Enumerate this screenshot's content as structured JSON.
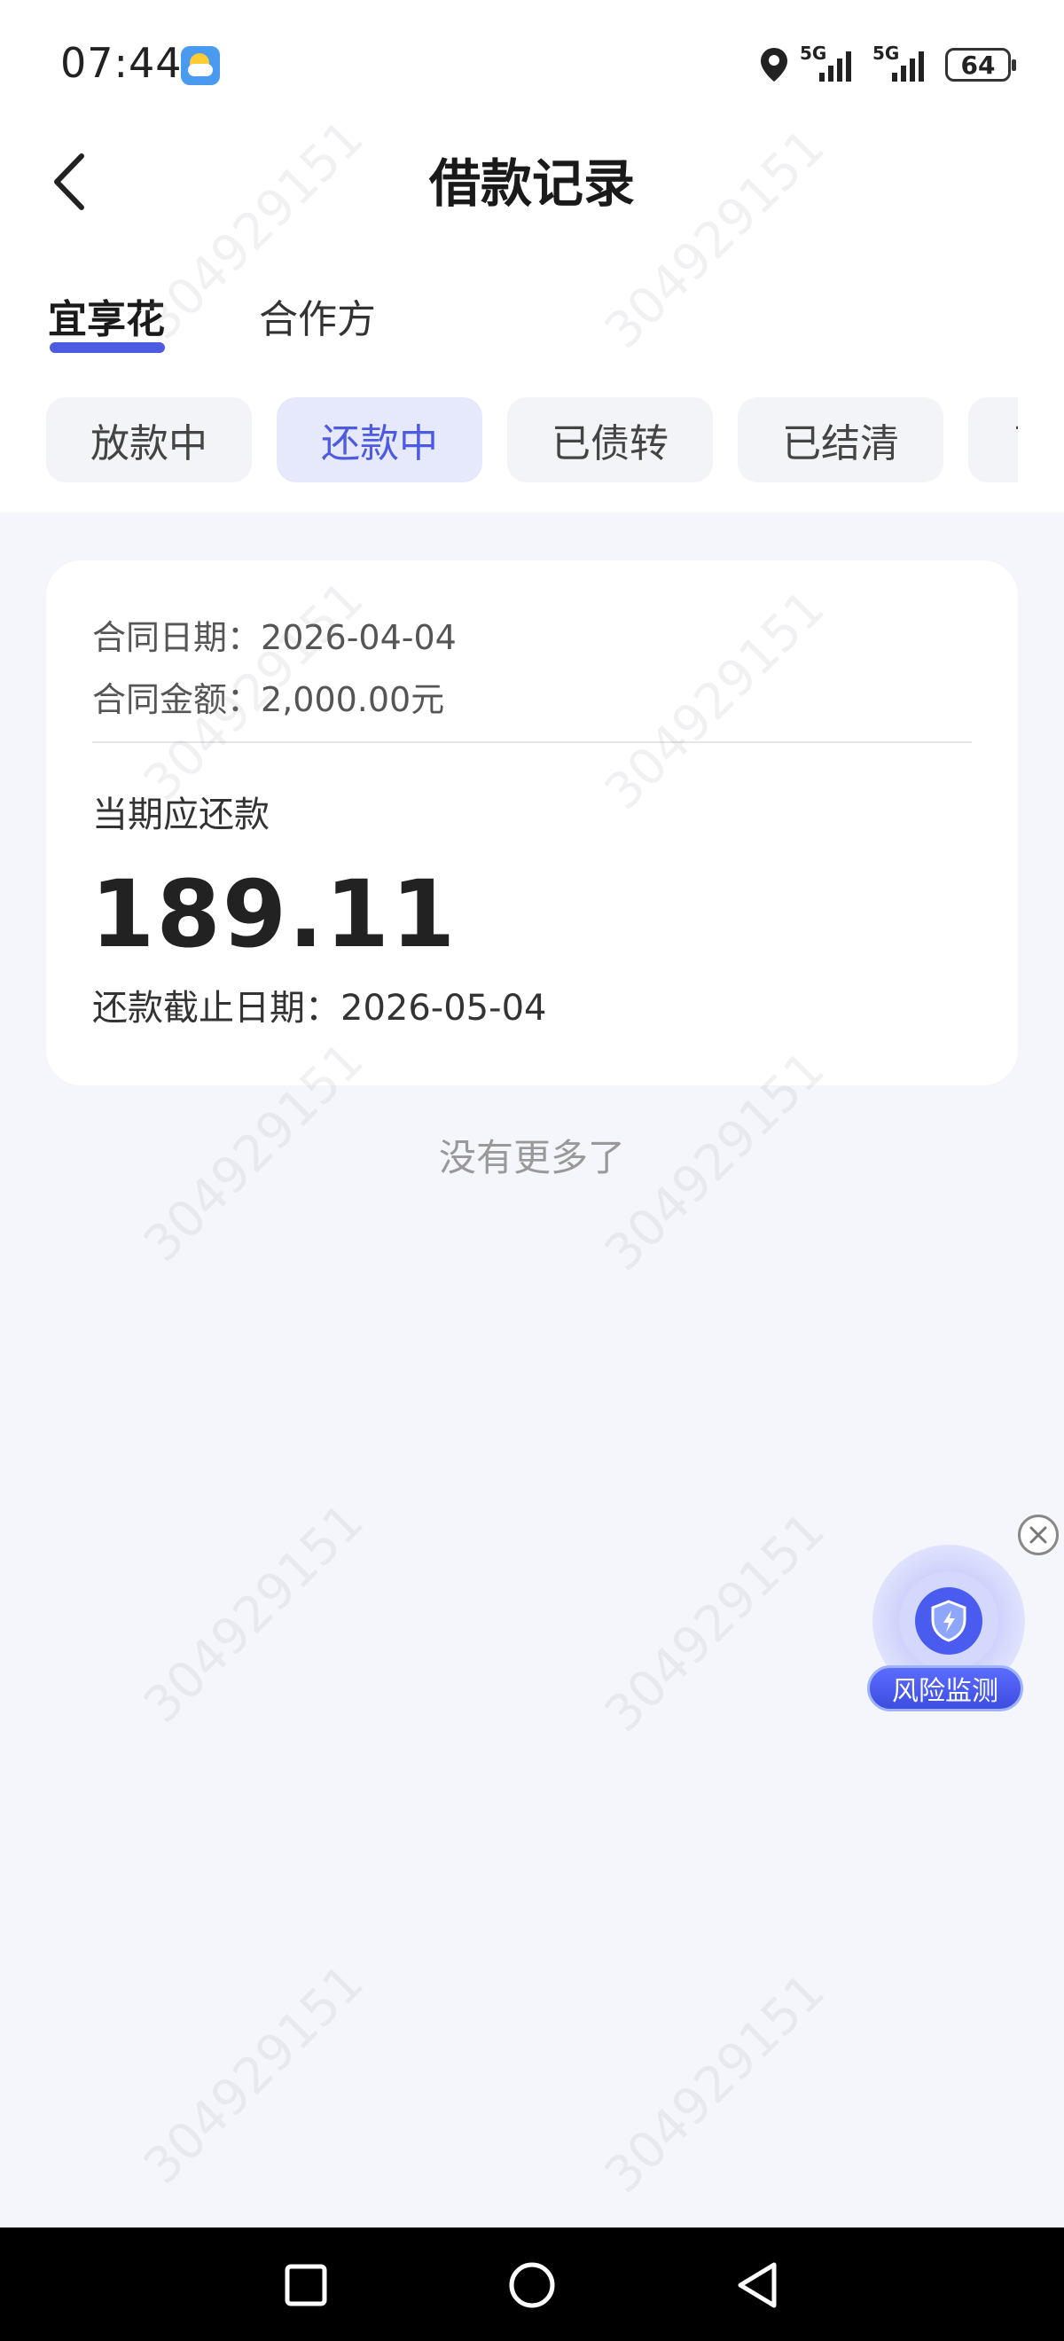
{
  "status_bar": {
    "time": "07:44",
    "weather_icon": "partly-cloudy-icon",
    "network_1": "5G",
    "network_2": "5G",
    "battery": "64"
  },
  "header": {
    "title": "借款记录",
    "back_icon": "chevron-left-icon"
  },
  "tabs": [
    {
      "label": "宜享花",
      "active": true
    },
    {
      "label": "合作方",
      "active": false
    }
  ],
  "filters": [
    {
      "label": "放款中",
      "active": false
    },
    {
      "label": "还款中",
      "active": true
    },
    {
      "label": "已债转",
      "active": false
    },
    {
      "label": "已结清",
      "active": false
    },
    {
      "label": "已",
      "active": false
    }
  ],
  "loan_card": {
    "contract_date_label": "合同日期：",
    "contract_date": "2026-04-04",
    "contract_amount_label": "合同金额：",
    "contract_amount": "2,000.00元",
    "due_label": "当期应还款",
    "due_amount": "189.11",
    "deadline_label": "还款截止日期：",
    "deadline": "2026-05-04"
  },
  "list_end_text": "没有更多了",
  "risk_widget": {
    "label": "风险监测",
    "icon": "shield-icon"
  },
  "watermark": "304929151",
  "colors": {
    "accent": "#4d5be0",
    "background": "#f5f6fb"
  }
}
